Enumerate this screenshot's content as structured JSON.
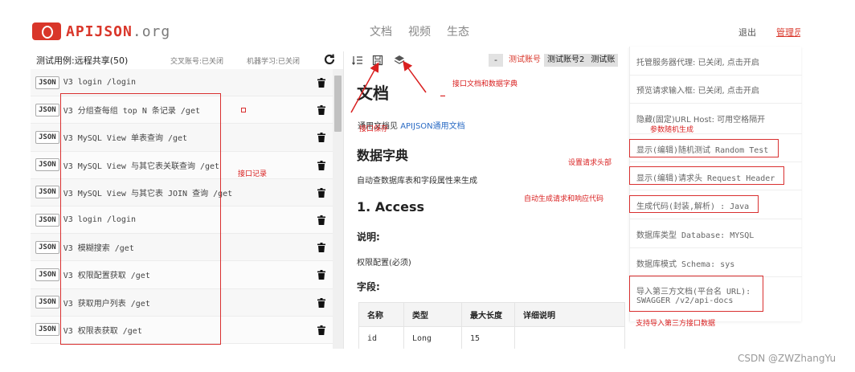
{
  "header": {
    "logo_name": "APIJSON",
    "logo_suffix": ".org",
    "nav": [
      "文档",
      "视频",
      "生态"
    ],
    "logout": "退出",
    "admin": "管理员"
  },
  "left_panel": {
    "title": "测试用例:远程共享(50)",
    "cross_account": "交叉账号:已关闭",
    "machine_learning": "机器学习:已关闭",
    "refresh_icon": "refresh-icon",
    "rows": [
      {
        "badge": "JSON",
        "text": "V3 login /login"
      },
      {
        "badge": "JSON",
        "text": "V3 分组查每组 top N 条记录 /get"
      },
      {
        "badge": "JSON",
        "text": "V3 MySQL View 单表查询 /get"
      },
      {
        "badge": "JSON",
        "text": "V3 MySQL View 与其它表关联查询 /get"
      },
      {
        "badge": "JSON",
        "text": "V3 MySQL View 与其它表 JOIN 查询 /get"
      },
      {
        "badge": "JSON",
        "text": "V3 login /login"
      },
      {
        "badge": "JSON",
        "text": "V3 模糊搜索 /get"
      },
      {
        "badge": "JSON",
        "text": "V3 权限配置获取 /get"
      },
      {
        "badge": "JSON",
        "text": "V3 获取用户列表 /get"
      },
      {
        "badge": "JSON",
        "text": "V3 权限表获取 /get"
      }
    ]
  },
  "middle_panel": {
    "minus": "-",
    "accounts": [
      "测试账号",
      "测试账号2",
      "测试账"
    ],
    "doc_title": "文档",
    "general_prefix": "通用文档见 ",
    "general_link": "APIJSON通用文档",
    "dict_title": "数据字典",
    "dict_desc": "自动查数据库表和字段属性来生成",
    "section_title": "1. Access",
    "desc_label": "说明:",
    "desc_value": "权限配置(必须)",
    "fields_label": "字段:",
    "table_headers": [
      "名称",
      "类型",
      "最大长度",
      "详细说明"
    ],
    "table_row": [
      "id",
      "Long",
      "15",
      ""
    ]
  },
  "menu": {
    "items": [
      "托管服务器代理: 已关闭, 点击开启",
      "预览请求输入框: 已关闭, 点击开启",
      "隐藏(固定)URL Host: 可用空格隔开",
      "显示(编辑)随机测试 Random Test",
      "显示(编辑)请求头 Request Header",
      "生成代码(封装,解析) : Java",
      "数据库类型 Database: MYSQL",
      "数据库模式 Schema: sys",
      "导入第三方文档(平台名 URL):",
      "SWAGGER /v2/api-docs"
    ]
  },
  "annotations": {
    "api_records": "接口记录",
    "api_save": "接口保存",
    "api_doc_dict": "接口文档和数据字典",
    "random_params": "参数随机生成",
    "set_headers": "设置请求头部",
    "auto_code": "自动生成请求和响应代码",
    "import_third_party": "支持导入第三方接口数据",
    "dash": "_"
  },
  "watermark": "CSDN @ZWZhangYu",
  "colors": {
    "brand_red": "#d9362a",
    "annotation_red": "#d92020",
    "link_blue": "#2a6bc4"
  }
}
